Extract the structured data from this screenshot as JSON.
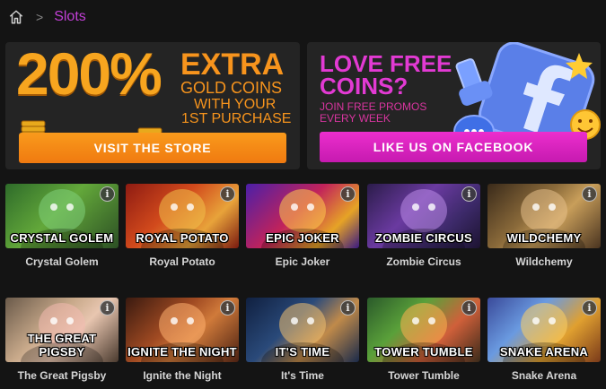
{
  "breadcrumb": {
    "current": "Slots",
    "separator": ">"
  },
  "store_banner": {
    "percent": "200%",
    "title": "EXTRA",
    "line2": "GOLD COINS",
    "line3": "WITH YOUR",
    "line4": "1ST PURCHASE",
    "button_label": "VISIT THE STORE",
    "color": "#f7941d"
  },
  "facebook_banner": {
    "title_line1": "LOVE FREE",
    "title_line2": "COINS?",
    "sub_line1": "JOIN FREE PROMOS",
    "sub_line2": "EVERY WEEK",
    "button_label": "LIKE US ON FACEBOOK",
    "color": "#e23ad3"
  },
  "games": [
    {
      "name": "Crystal Golem",
      "thumb_title": "CRYSTAL GOLEM",
      "bg": "linear-gradient(135deg,#2e6b2a,#63a83a 45%,#2c4f24)",
      "accent": "#7fd07a"
    },
    {
      "name": "Royal Potato",
      "thumb_title": "ROYAL POTATO",
      "bg": "linear-gradient(135deg,#8e1b12,#d24a1c 40%,#e8a33a 70%,#7a1a10)",
      "accent": "#f1c14a"
    },
    {
      "name": "Epic Joker",
      "thumb_title": "EPIC JOKER",
      "bg": "linear-gradient(135deg,#4b1fa8,#c2235a 45%,#e6a326 75%,#3a1a82)",
      "accent": "#ffcc4d"
    },
    {
      "name": "Zombie Circus",
      "thumb_title": "ZOMBIE CIRCUS",
      "bg": "linear-gradient(135deg,#2b1c4a,#6a3aa0 40%,#3d2a6a 70%,#1c1330)",
      "accent": "#b98ae6"
    },
    {
      "name": "Wildchemy",
      "thumb_title": "WILDCHEMY",
      "bg": "linear-gradient(135deg,#3a2a1a,#8a6a3a 40%,#c89e5a 60%,#4a3420)",
      "accent": "#e6c08a"
    },
    {
      "name": "The Great Pigsby",
      "thumb_title": "THE GREAT PIGSBY",
      "bg": "linear-gradient(135deg,#6a5a4a,#c8a98a 40%,#e8c6b0 60%,#4a3a2e)",
      "accent": "#f2b9b0"
    },
    {
      "name": "Ignite the Night",
      "thumb_title": "IGNITE THE NIGHT",
      "bg": "linear-gradient(135deg,#3a1a10,#a04a22 40%,#d07a3a 60%,#4a2012)",
      "accent": "#ffb070"
    },
    {
      "name": "It's Time",
      "thumb_title": "IT'S TIME",
      "bg": "linear-gradient(135deg,#102040,#2a4a7a 40%,#c08a4a 65%,#1a2a4a)",
      "accent": "#f0c070"
    },
    {
      "name": "Tower Tumble",
      "thumb_title": "TOWER TUMBLE",
      "bg": "linear-gradient(135deg,#2a5a2a,#5aa03a 35%,#d0603a 65%,#3a2a1a)",
      "accent": "#ffb050"
    },
    {
      "name": "Snake Arena",
      "thumb_title": "SNAKE ARENA",
      "bg": "linear-gradient(135deg,#3a4a9a,#6a9ae0 35%,#e0a030 65%,#7a3a1a)",
      "accent": "#ffd060"
    }
  ],
  "info_symbol": "i"
}
